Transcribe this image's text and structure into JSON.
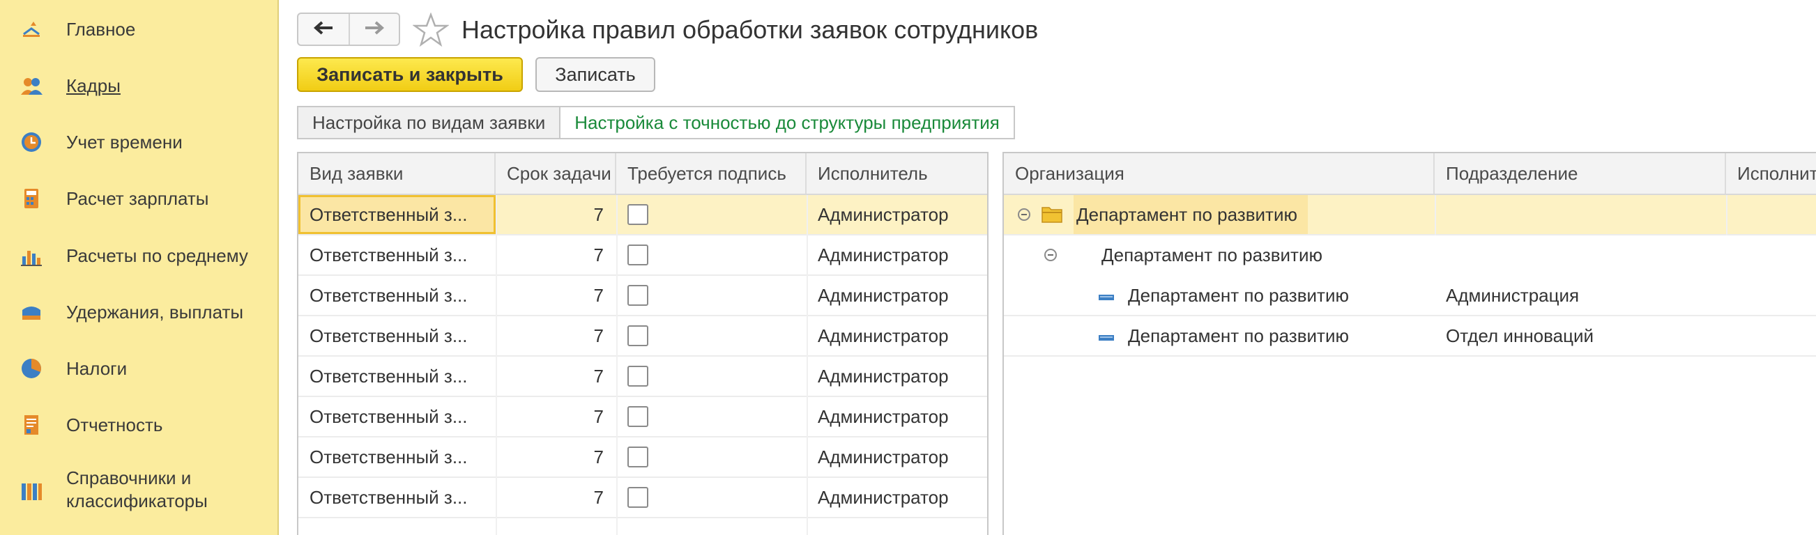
{
  "sidebar": {
    "items": [
      {
        "label": "Главное",
        "icon": "home-icon"
      },
      {
        "label": "Кадры",
        "icon": "people-icon"
      },
      {
        "label": "Учет времени",
        "icon": "clock-icon"
      },
      {
        "label": "Расчет зарплаты",
        "icon": "calculator-icon"
      },
      {
        "label": "Расчеты по среднему",
        "icon": "bar-chart-icon"
      },
      {
        "label": "Удержания, выплаты",
        "icon": "wallet-icon"
      },
      {
        "label": "Налоги",
        "icon": "pie-chart-icon"
      },
      {
        "label": "Отчетность",
        "icon": "report-icon"
      },
      {
        "label": "Справочники и",
        "label2": "классификаторы",
        "icon": "books-icon"
      }
    ]
  },
  "header": {
    "title": "Настройка правил обработки заявок сотрудников",
    "back_icon": "arrow-left-icon",
    "forward_icon": "arrow-right-icon",
    "favorite_icon": "star-icon"
  },
  "toolbar": {
    "save_close_label": "Записать и закрыть",
    "save_label": "Записать"
  },
  "tabs": [
    {
      "label": "Настройка по видам заявки"
    },
    {
      "label": "Настройка с точностью до структуры предприятия"
    }
  ],
  "left_table": {
    "columns": [
      "Вид заявки",
      "Срок задачи",
      "Требуется подпись",
      "Исполнитель"
    ],
    "rows": [
      {
        "type": "Ответственный з...",
        "term": "7",
        "signature": false,
        "executor": "Администратор"
      },
      {
        "type": "Ответственный з...",
        "term": "7",
        "signature": false,
        "executor": "Администратор"
      },
      {
        "type": "Ответственный з...",
        "term": "7",
        "signature": false,
        "executor": "Администратор"
      },
      {
        "type": "Ответственный з...",
        "term": "7",
        "signature": false,
        "executor": "Администратор"
      },
      {
        "type": "Ответственный з...",
        "term": "7",
        "signature": false,
        "executor": "Администратор"
      },
      {
        "type": "Ответственный з...",
        "term": "7",
        "signature": false,
        "executor": "Администратор"
      },
      {
        "type": "Ответственный з...",
        "term": "7",
        "signature": false,
        "executor": "Администратор"
      },
      {
        "type": "Ответственный з...",
        "term": "7",
        "signature": false,
        "executor": "Администратор"
      }
    ]
  },
  "right_table": {
    "columns": [
      "Организация",
      "Подразделение",
      "Исполнит"
    ],
    "rows": [
      {
        "org": "Департамент по развитию",
        "division": "",
        "executor": ""
      },
      {
        "org": "Департамент по развитию",
        "division": "",
        "executor": ""
      },
      {
        "org": "Департамент по развитию",
        "division": "Администрация",
        "executor": ""
      },
      {
        "org": "Департамент по развитию",
        "division": "Отдел инноваций",
        "executor": ""
      }
    ]
  },
  "colors": {
    "sidebar_bg": "#fbec9e",
    "primary_button": "#f5d21f",
    "active_tab_text": "#1a8a3a",
    "selected_row": "#fdf2c4"
  }
}
